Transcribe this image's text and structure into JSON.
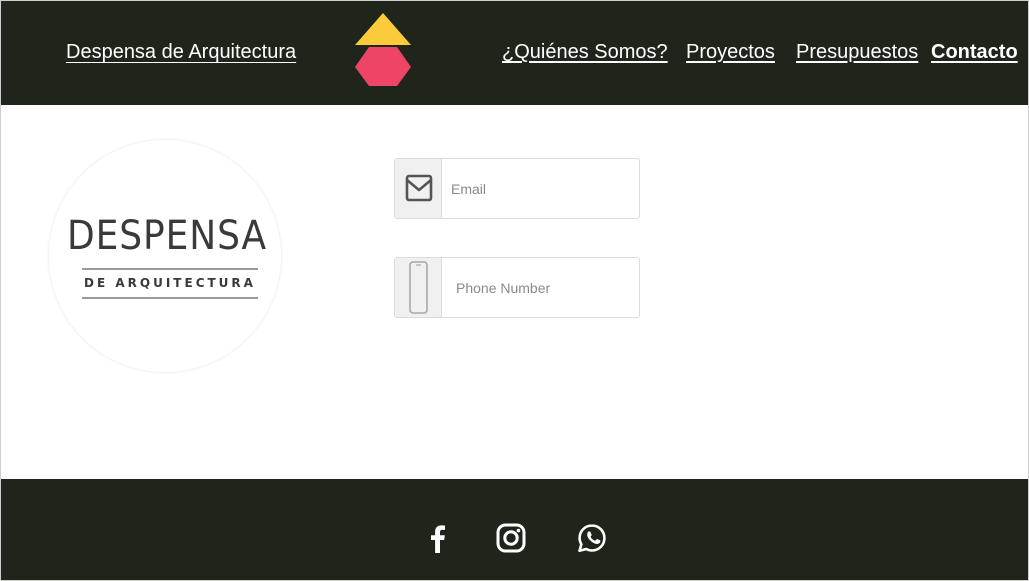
{
  "header": {
    "site_title": "Despensa de Arquitectura",
    "nav": [
      {
        "label": "¿Quiénes Somos?",
        "active": false
      },
      {
        "label": "Proyectos",
        "active": false
      },
      {
        "label": "Presupuestos",
        "active": false
      },
      {
        "label": "Contacto",
        "active": true
      }
    ],
    "logo_colors": {
      "triangle": "#fccb3b",
      "hexagon": "#ee4466"
    }
  },
  "brand_logo": {
    "word": "DESPENSA",
    "subtitle": "DE ARQUITECTURA"
  },
  "form": {
    "email": {
      "placeholder": "Email",
      "value": "",
      "icon": "envelope-icon"
    },
    "phone": {
      "placeholder": "Phone Number",
      "value": "",
      "icon": "phone-icon"
    }
  },
  "footer": {
    "social": [
      {
        "name": "facebook",
        "icon": "facebook-icon"
      },
      {
        "name": "instagram",
        "icon": "instagram-icon"
      },
      {
        "name": "whatsapp",
        "icon": "whatsapp-icon"
      }
    ]
  },
  "colors": {
    "dark_bg": "#20251c",
    "text_light": "#ffffff"
  }
}
